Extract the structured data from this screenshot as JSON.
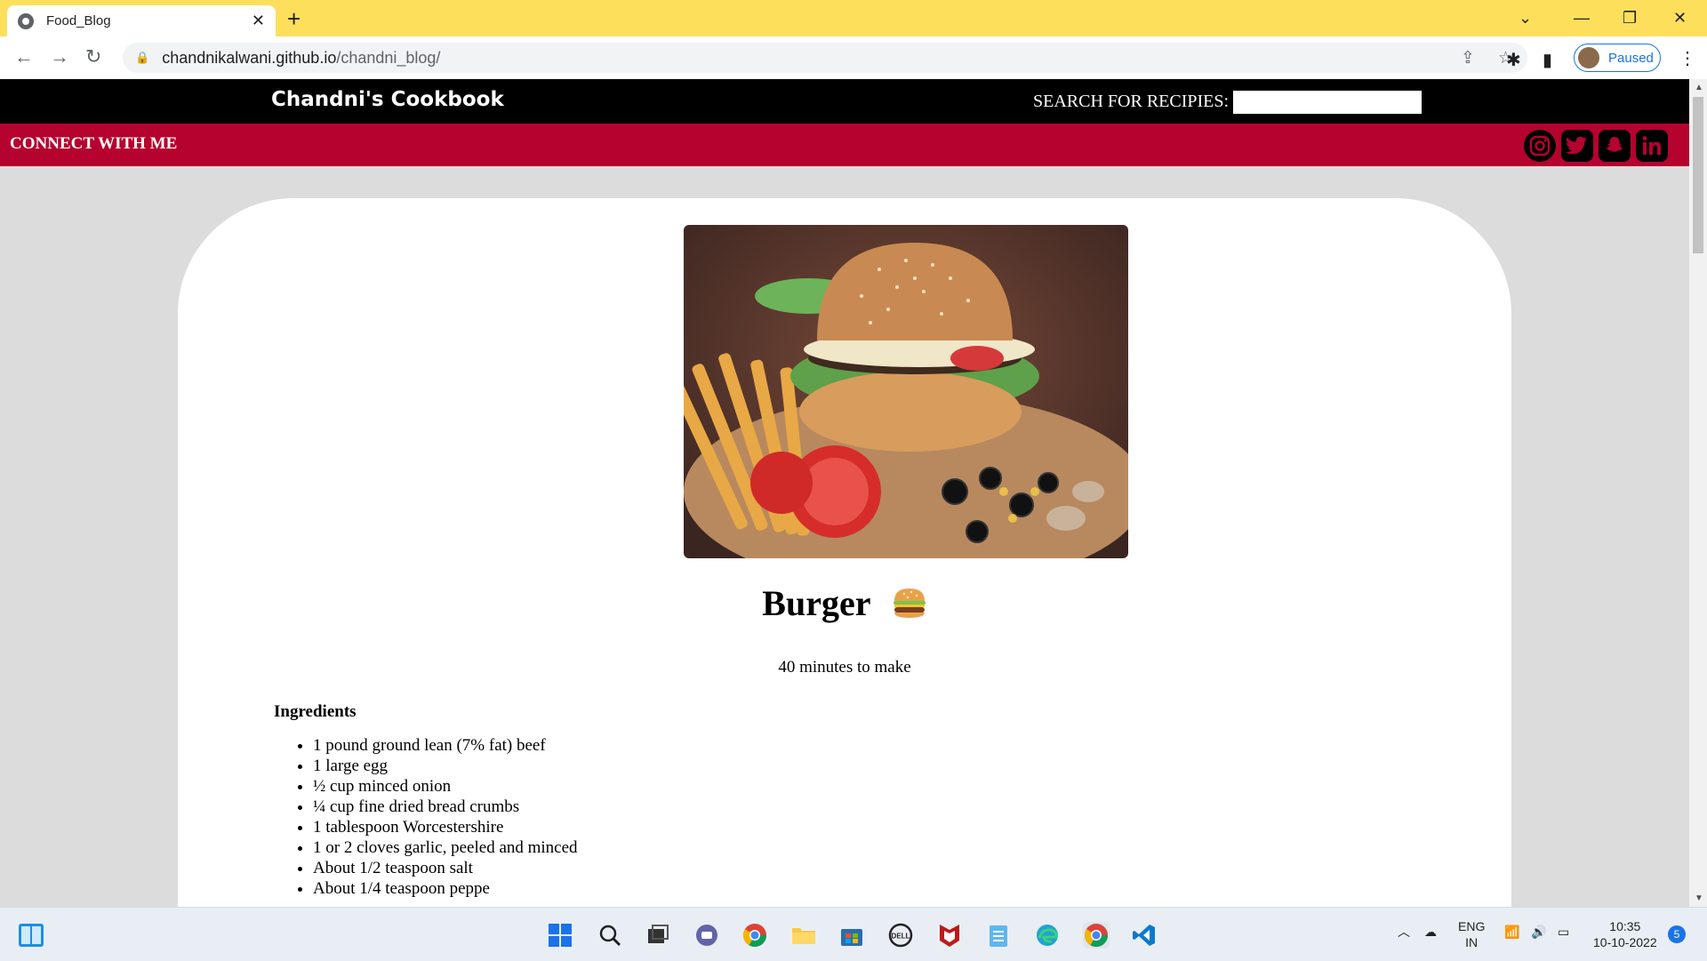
{
  "browser": {
    "tab_title": "Food_Blog",
    "url_host": "chandnikalwani.github.io",
    "url_path": "/chandni_blog/",
    "profile_status": "Paused"
  },
  "site": {
    "brand": "Chandni's Cookbook",
    "search_label": "SEARCH FOR RECIPIES:",
    "search_value": "",
    "connect_label": "CONNECT WITH ME",
    "social_icons": [
      "instagram-icon",
      "twitter-icon",
      "snapchat-icon",
      "linkedin-icon"
    ]
  },
  "recipe": {
    "title": "Burger",
    "emoji": "🍔",
    "time": "40 minutes to make",
    "ingredients_heading": "Ingredients",
    "ingredients": [
      "1 pound ground lean (7% fat) beef",
      "1 large egg",
      "½ cup minced onion",
      "¼ cup fine dried bread crumbs",
      "1 tablespoon Worcestershire",
      "1 or 2 cloves garlic, peeled and minced",
      "About 1/2 teaspoon salt",
      "About 1/4 teaspoon peppe"
    ]
  },
  "taskbar": {
    "lang": "ENG",
    "region": "IN",
    "time": "10:35",
    "date": "10-10-2022",
    "notification_count": "5"
  },
  "colors": {
    "tabstrip": "#fddf5c",
    "topbar": "#000000",
    "connectbar": "#b5022f",
    "page_bg": "#dcdcdc"
  }
}
